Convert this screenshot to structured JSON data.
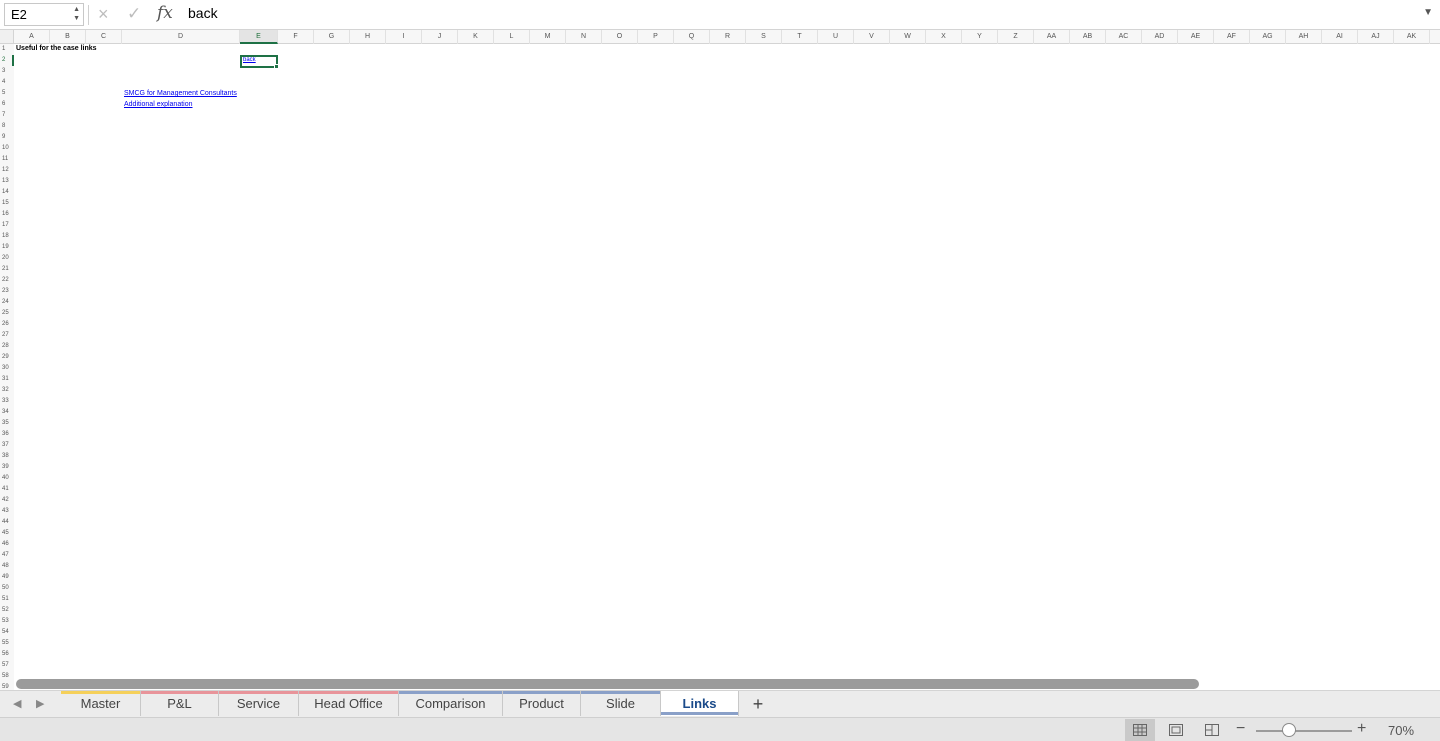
{
  "formula_bar": {
    "name_box": "E2",
    "formula_value": "back",
    "fx_label": "fx"
  },
  "columns": [
    "A",
    "B",
    "C",
    "D",
    "E",
    "F",
    "G",
    "H",
    "I",
    "J",
    "K",
    "L",
    "M",
    "N",
    "O",
    "P",
    "Q",
    "R",
    "S",
    "T",
    "U",
    "V",
    "W",
    "X",
    "Y",
    "Z",
    "AA",
    "AB",
    "AC",
    "AD",
    "AE",
    "AF",
    "AG",
    "AH",
    "AI",
    "AJ",
    "AK"
  ],
  "active_column": "E",
  "active_row": 2,
  "row_count": 59,
  "cells": {
    "a1": "Useful for the case links",
    "e2": "back",
    "d5": "SMCG for Management Consultants",
    "d6": "Additional explanation"
  },
  "sheet_tabs": [
    {
      "label": "Master",
      "color": "#f5d05a"
    },
    {
      "label": "P&L",
      "color": "#e8949a"
    },
    {
      "label": "Service",
      "color": "#e8949a"
    },
    {
      "label": "Head Office",
      "color": "#e8949a"
    },
    {
      "label": "Comparison",
      "color": "#8aa0c8"
    },
    {
      "label": "Product",
      "color": "#8aa0c8"
    },
    {
      "label": "Slide",
      "color": "#8aa0c8"
    },
    {
      "label": "Links",
      "color": "#8aa0c8",
      "active": true
    }
  ],
  "add_sheet_label": "+",
  "status": {
    "zoom": "70%",
    "zoom_minus": "−",
    "zoom_plus": "+"
  },
  "icons": {
    "cancel": "×",
    "enter": "✓",
    "prev_sheet": "◀",
    "next_sheet": "▶",
    "expand": "▼"
  },
  "accent_color": "#1e7145"
}
